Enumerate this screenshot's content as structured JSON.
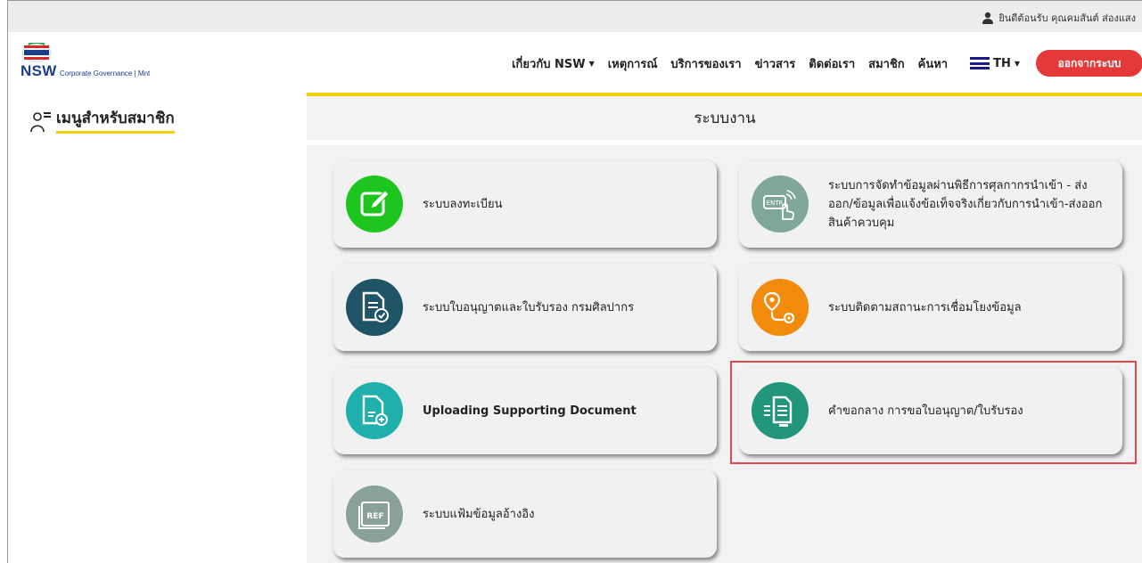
{
  "header": {
    "welcome_text": "ยินดีต้อนรับ คุณคมสันต์ ส่องแสง",
    "logo_text": "NSW",
    "logo_subtext": "Corporate Governance | Mnt"
  },
  "nav": {
    "items": [
      {
        "label": "เกี่ยวกับ NSW",
        "dropdown": true
      },
      {
        "label": "เหตุการณ์",
        "dropdown": false
      },
      {
        "label": "บริการของเรา",
        "dropdown": false
      },
      {
        "label": "ข่าวสาร",
        "dropdown": false
      },
      {
        "label": "ติดต่อเรา",
        "dropdown": false
      },
      {
        "label": "สมาชิก",
        "dropdown": false
      },
      {
        "label": "ค้นหา",
        "dropdown": false
      }
    ],
    "language": "TH",
    "logout_label": "ออกจากระบบ"
  },
  "sidebar": {
    "title": "เมนูสำหรับสมาชิก"
  },
  "main": {
    "title": "ระบบงาน",
    "cards": [
      {
        "label": "ระบบลงทะเบียน",
        "icon": "edit-icon",
        "color": "#1ec51e"
      },
      {
        "label": "ระบบการจัดทำข้อมูลผ่านพิธีการศุลกากรนำเข้า - ส่งออก/ข้อมูลเพื่อแจ้งข้อเท็จจริงเกี่ยวกับการนำเข้า-ส่งออก สินค้าควบคุม",
        "icon": "entry-touch-icon",
        "color": "#7fa89a"
      },
      {
        "label": "ระบบใบอนุญาตและใบรับรอง กรมศิลปากร",
        "icon": "document-check-icon",
        "color": "#1f5466"
      },
      {
        "label": "ระบบติดตามสถานะการเชื่อมโยงข้อมูล",
        "icon": "route-pin-icon",
        "color": "#f28a0b"
      },
      {
        "label": "Uploading Supporting Document",
        "icon": "document-add-icon",
        "color": "#1fb0ad"
      },
      {
        "label": "คำขอกลาง การขอใบอนุญาต/ใบรับรอง",
        "icon": "document-send-icon",
        "color": "#21967a"
      },
      {
        "label": "ระบบแฟ้มข้อมูลอ้างอิง",
        "icon": "ref-folder-icon",
        "color": "#8aa09a"
      }
    ]
  }
}
